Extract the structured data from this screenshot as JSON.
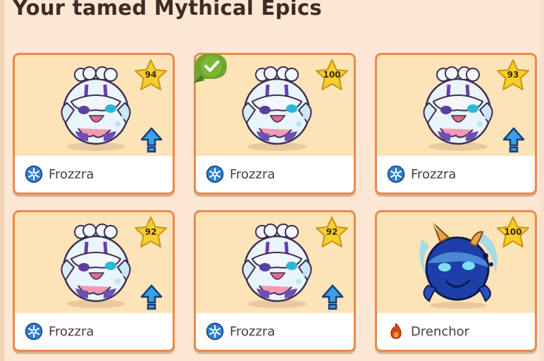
{
  "page": {
    "title": "Your tamed Mythical Epics"
  },
  "cards": [
    {
      "name": "Frozzra",
      "level": "94",
      "element": "ice-element-icon",
      "selected": false,
      "upgrade": true
    },
    {
      "name": "Frozzra",
      "level": "100",
      "element": "ice-element-icon",
      "selected": true,
      "upgrade": false
    },
    {
      "name": "Frozzra",
      "level": "93",
      "element": "ice-element-icon",
      "selected": false,
      "upgrade": true
    },
    {
      "name": "Frozzra",
      "level": "92",
      "element": "ice-element-icon",
      "selected": false,
      "upgrade": true
    },
    {
      "name": "Frozzra",
      "level": "92",
      "element": "ice-element-icon",
      "selected": false,
      "upgrade": true
    },
    {
      "name": "Drenchor",
      "level": "100",
      "element": "fire-element-icon",
      "selected": false,
      "upgrade": false
    }
  ],
  "colors": {
    "background": "#fbe7d4",
    "card_border": "#e98a4a",
    "card_fill": "#fde3b8",
    "star": "#f6cf2b",
    "ice": "#2f7fd3",
    "fire": "#e2471b",
    "check": "#6fa52e",
    "upgrade_arrow": "#3aa0e8"
  }
}
